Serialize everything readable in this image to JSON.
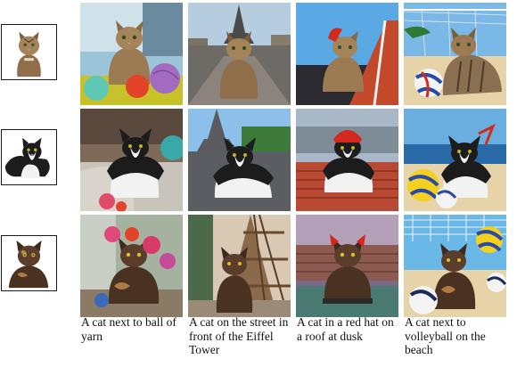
{
  "reference_images": [
    {
      "subject": "tabby cat",
      "background": "white"
    },
    {
      "subject": "black and white cat",
      "background": "white"
    },
    {
      "subject": "tortoiseshell cat",
      "background": "white"
    }
  ],
  "captions": [
    "A cat next to ball of yarn",
    "A cat on the street in front of the Eiffel Tower",
    "A cat in a red hat on a roof at dusk",
    "A cat next to volleyball on the beach"
  ],
  "grid": {
    "rows": [
      "tabby cat",
      "black and white cat",
      "tortoiseshell cat"
    ],
    "columns": [
      "yarn",
      "eiffel-tower-street",
      "red-hat-roof-dusk",
      "volleyball-beach"
    ]
  },
  "colors": {
    "tabby_fur": "#9c7a52",
    "tuxedo_black": "#1c1c1c",
    "tuxedo_white": "#f2f2f2",
    "tortie_fur": "#5a3d2a",
    "hat_red": "#d42a1e",
    "sky_blue": "#6aaee0",
    "sand": "#e6d3a8"
  }
}
